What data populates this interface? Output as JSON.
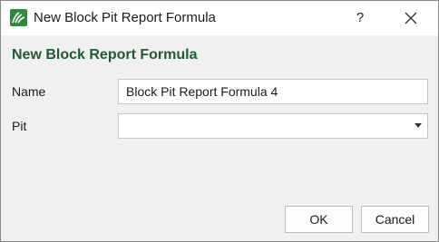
{
  "window": {
    "title": "New Block Pit Report Formula",
    "help_label": "?",
    "app_icon": "green-pit-logo-icon",
    "accent_color": "#1e5b35"
  },
  "form": {
    "header": "New Block Report Formula",
    "name_label": "Name",
    "name_value": "Block Pit Report Formula 4",
    "pit_label": "Pit",
    "pit_value": ""
  },
  "buttons": {
    "ok_label": "OK",
    "cancel_label": "Cancel"
  }
}
